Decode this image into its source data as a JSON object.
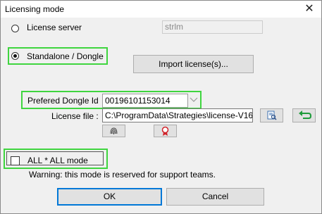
{
  "window": {
    "title": "Licensing mode"
  },
  "options": {
    "license_server_label": "License server",
    "license_server_value": "strlm",
    "standalone_label": "Standalone / Dongle",
    "import_button": "Import license(s)...",
    "dongle_label": "Prefered Dongle Id",
    "dongle_value": "00196101153014",
    "license_file_label": "License file :",
    "license_file_value": "C:\\ProgramData\\Strategies\\license-V16."
  },
  "all_mode": {
    "label": "ALL * ALL mode",
    "warning": "Warning: this mode is reserved for support teams."
  },
  "footer": {
    "ok_label": "OK",
    "cancel_label": "Cancel"
  },
  "colors": {
    "highlight": "#3fd53f",
    "accent": "#0078d7"
  }
}
